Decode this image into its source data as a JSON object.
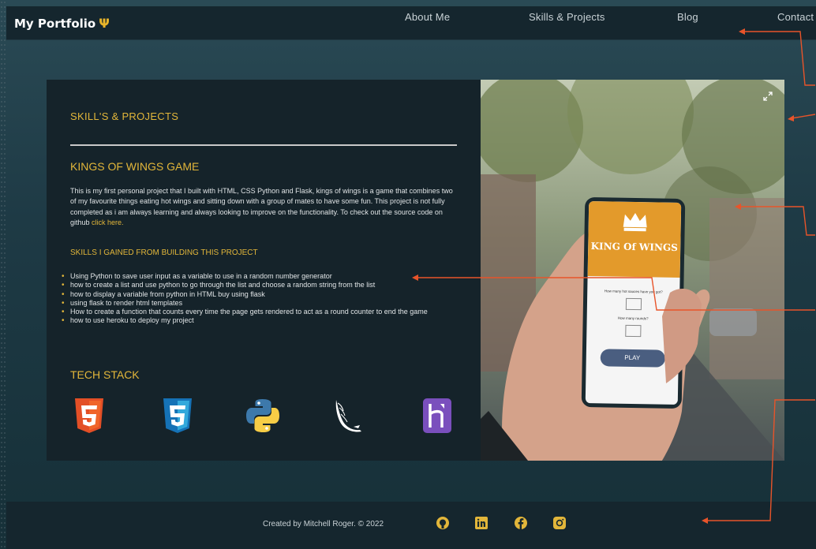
{
  "nav": {
    "brand": "My Portfolio",
    "brand_icon": "trident-icon",
    "links": [
      "About Me",
      "Skills & Projects",
      "Blog",
      "Contact"
    ]
  },
  "section": {
    "title": "SKILL'S & PROJECTS",
    "project_title": "KINGS OF WINGS GAME",
    "description": "This is my first personal project that I built with HTML, CSS Python and Flask, kings of wings is a game that combines two of my favourite things eating hot wings and sitting down with a group of mates to have some fun. This project is not fully completed as i am always learning and always looking to improve on the functionality. To check out the source code on github",
    "link_text": "click here.",
    "skills_title": "SKILLS I GAINED FROM BUILDING THIS PROJECT",
    "skills": [
      "Using Python to save user input as a variable to use in a random number generator",
      "how to create a list and use python to go through the list and choose a random string from the list",
      "how to display a variable from python in HTML buy using flask",
      "using flask to render html templates",
      "How to create a function that counts every time the page gets rendered to act as a round counter to end the game",
      "how to use heroku to deploy my project"
    ],
    "tech_title": "TECH STACK",
    "tech_icons": [
      "html5-icon",
      "css3-icon",
      "python-icon",
      "flask-icon",
      "heroku-icon"
    ]
  },
  "phone": {
    "app_title": "KING Of WINGS",
    "q1": "How many hot sauces have you got?",
    "q2": "How many rounds?",
    "play": "PLAY"
  },
  "footer": {
    "text": "Created by Mitchell Roger. © 2022",
    "social_icons": [
      "github-icon",
      "linkedin-icon",
      "facebook-icon",
      "instagram-icon"
    ]
  },
  "colors": {
    "accent": "#e2b63a",
    "annotation": "#e8542a",
    "nav_bg": "#15262e"
  }
}
